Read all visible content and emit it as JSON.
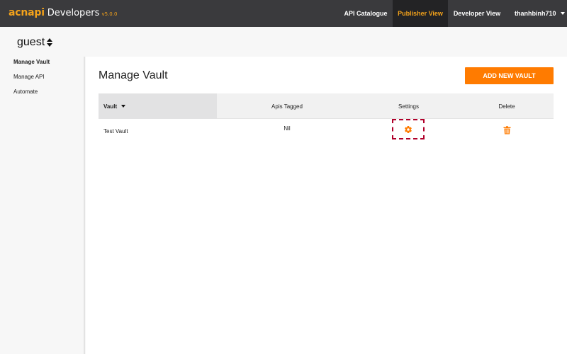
{
  "brand": {
    "acn": "acn",
    "api": "api",
    "developers": "Developers",
    "version": "v5.0.0",
    "accent_color": "#f3a21b"
  },
  "nav": {
    "items": [
      {
        "label": "API Catalogue"
      },
      {
        "label": "Publisher View",
        "active": true
      },
      {
        "label": "Developer View"
      }
    ],
    "user": "thanhbinh710"
  },
  "account": {
    "name": "guest"
  },
  "sidebar": {
    "items": [
      {
        "label": "Manage Vault",
        "active": true
      },
      {
        "label": "Manage API"
      },
      {
        "label": "Automate"
      }
    ]
  },
  "main": {
    "title": "Manage Vault",
    "add_button": "ADD NEW VAULT",
    "button_color": "#ff7b00",
    "table": {
      "headers": [
        "Vault",
        "Apis Tagged",
        "Settings",
        "Delete"
      ],
      "rows": [
        {
          "name": "Test Vault",
          "apis": "Nil"
        }
      ]
    }
  },
  "icons": {
    "settings": "gear-icon",
    "delete": "trash-icon",
    "sort": "sort-icon",
    "dropdown": "chevron-down-icon"
  }
}
